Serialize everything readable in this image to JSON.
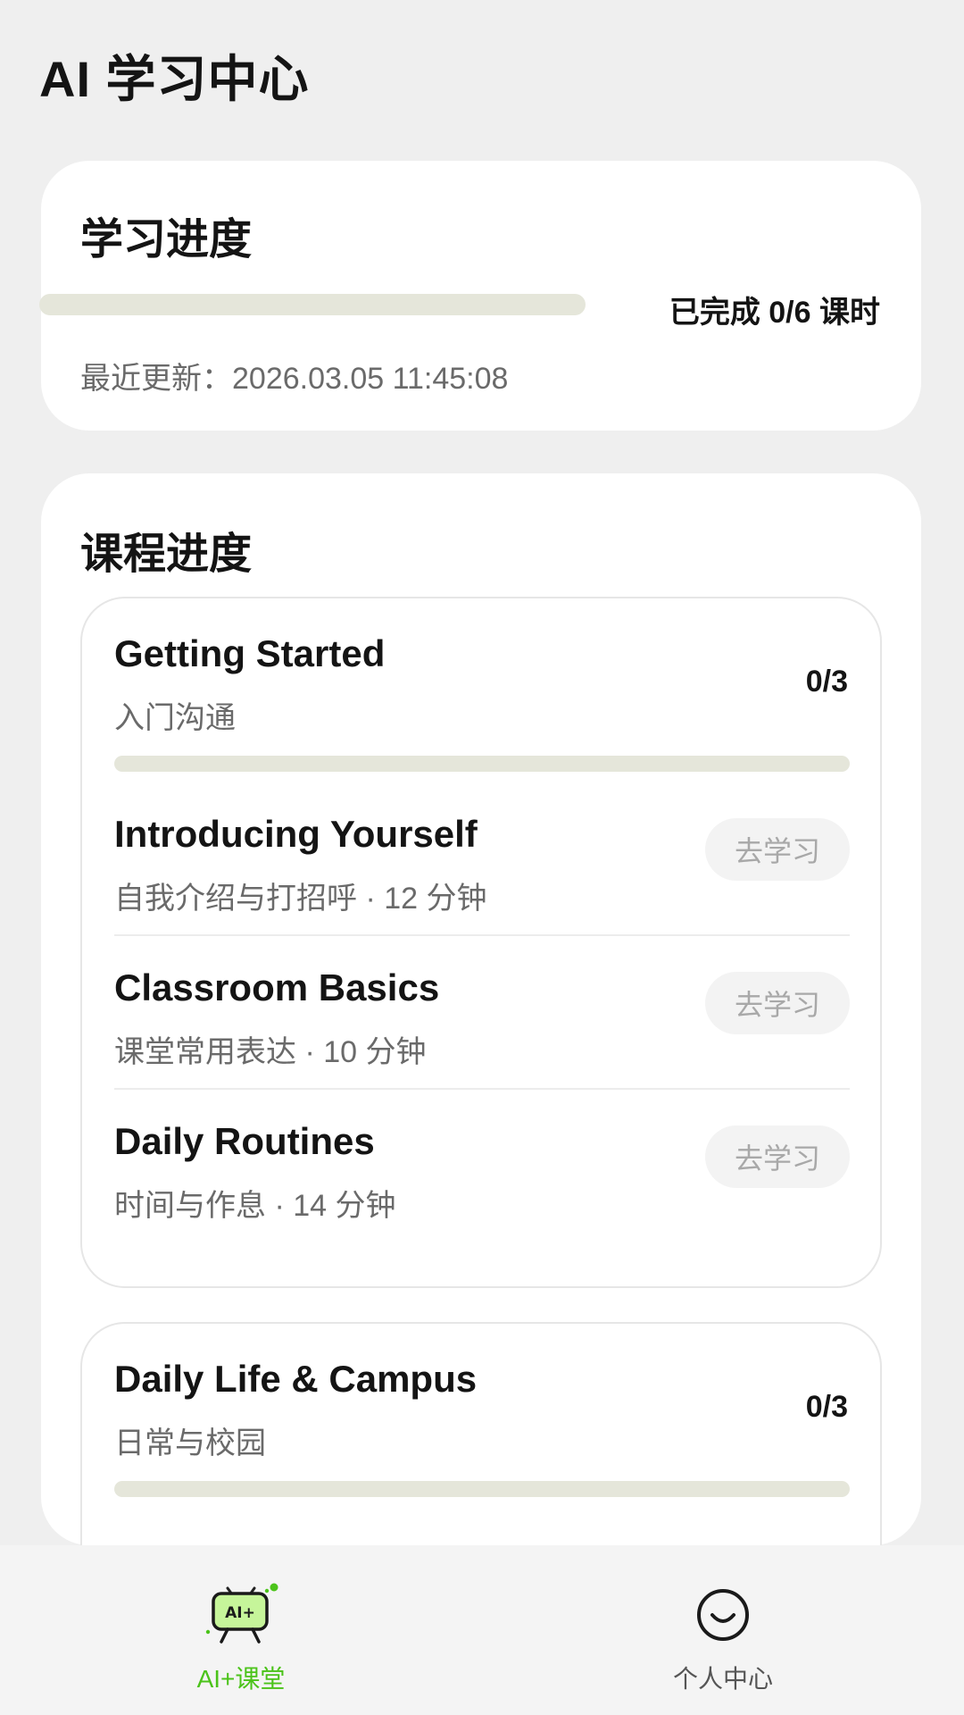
{
  "header": {
    "title": "AI 学习中心"
  },
  "learning_progress": {
    "heading": "学习进度",
    "completed_text": "已完成 0/6 课时",
    "completed_fraction": 0,
    "last_updated_label": "最近更新：",
    "last_updated_value": "2026.03.05 11:45:08"
  },
  "course_progress": {
    "heading": "课程进度",
    "modules": [
      {
        "title": "Getting Started",
        "subtitle": "入门沟通",
        "count": "0/3",
        "progress_fraction": 0,
        "lessons": [
          {
            "title": "Introducing Yourself",
            "description": "自我介绍与打招呼",
            "separator": " · ",
            "duration": "12 分钟",
            "action": "去学习"
          },
          {
            "title": "Classroom Basics",
            "description": "课堂常用表达",
            "separator": " · ",
            "duration": "10 分钟",
            "action": "去学习"
          },
          {
            "title": "Daily Routines",
            "description": "时间与作息",
            "separator": " · ",
            "duration": "14 分钟",
            "action": "去学习"
          }
        ]
      },
      {
        "title": "Daily Life & Campus",
        "subtitle": "日常与校园",
        "count": "0/3",
        "progress_fraction": 0
      }
    ]
  },
  "tab_bar": {
    "tabs": [
      {
        "label": "AI+课堂",
        "icon": "ai-classroom-icon",
        "icon_text": "AI+",
        "active": true
      },
      {
        "label": "个人中心",
        "icon": "smiley-face-icon",
        "active": false
      }
    ]
  },
  "colors": {
    "accent": "#4bc31a",
    "background": "#efefef",
    "card": "#ffffff",
    "progress_track": "#e5e6da",
    "button_bg": "#f3f3f3",
    "button_text": "#a8a8a8",
    "muted_text": "#6a6a6a",
    "inactive_tab": "#555555"
  }
}
